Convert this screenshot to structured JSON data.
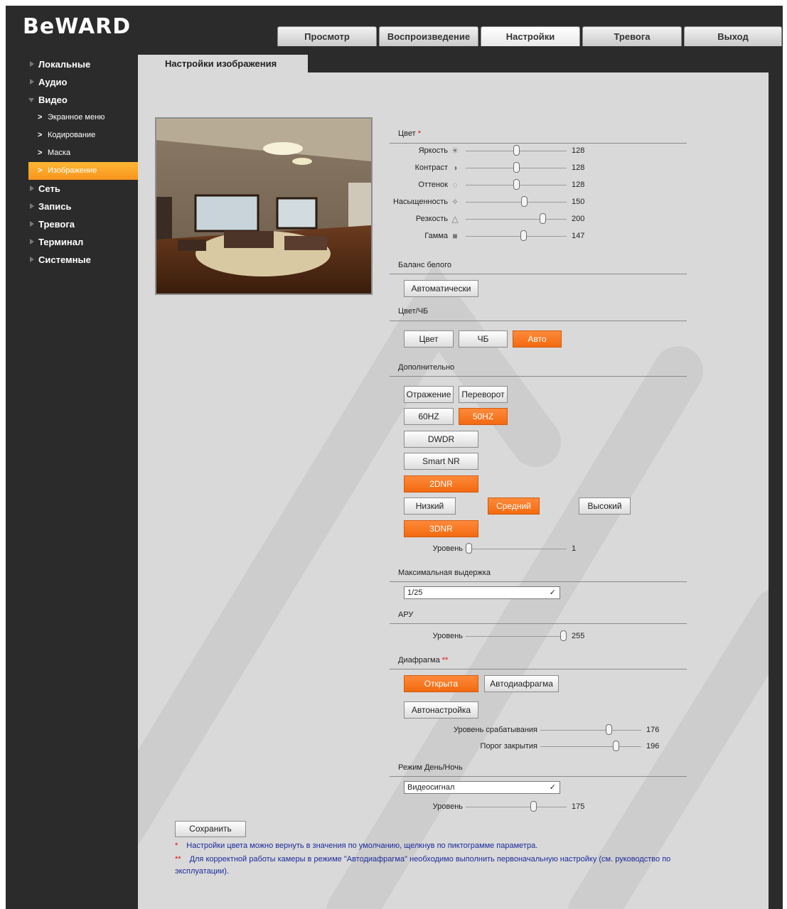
{
  "logo": "BeWARD",
  "tabs": [
    "Просмотр",
    "Воспроизведение",
    "Настройки",
    "Тревога",
    "Выход"
  ],
  "sidebar": {
    "items": [
      {
        "label": "Локальные"
      },
      {
        "label": "Аудио"
      },
      {
        "label": "Видео"
      },
      {
        "label": "Экранное меню"
      },
      {
        "label": "Кодирование"
      },
      {
        "label": "Маска"
      },
      {
        "label": "Изображение"
      },
      {
        "label": "Сеть"
      },
      {
        "label": "Запись"
      },
      {
        "label": "Тревога"
      },
      {
        "label": "Терминал"
      },
      {
        "label": "Системные"
      }
    ]
  },
  "content_tab": "Настройки изображения",
  "color": {
    "title": "Цвет",
    "required_mark": "*",
    "sliders": [
      {
        "label": "Яркость",
        "value": "128",
        "level": 128,
        "max": 255,
        "icon": "brightness-icon"
      },
      {
        "label": "Контраст",
        "value": "128",
        "level": 128,
        "max": 255,
        "icon": "contrast-icon"
      },
      {
        "label": "Оттенок",
        "value": "128",
        "level": 128,
        "max": 255,
        "icon": "hue-icon"
      },
      {
        "label": "Насыщенность",
        "value": "150",
        "level": 150,
        "max": 255,
        "icon": "saturation-icon"
      },
      {
        "label": "Резкость",
        "value": "200",
        "level": 200,
        "max": 255,
        "icon": "sharpness-icon"
      },
      {
        "label": "Гамма",
        "value": "147",
        "level": 147,
        "max": 255,
        "icon": "gamma-icon"
      }
    ]
  },
  "white_balance": {
    "title": "Баланс белого",
    "button": "Автоматически"
  },
  "color_bw": {
    "title": "Цвет/ЧБ",
    "buttons": [
      "Цвет",
      "ЧБ",
      "Авто"
    ],
    "active": "Авто"
  },
  "advanced": {
    "title": "Дополнительно",
    "mirror": "Отражение",
    "flip": "Переворот",
    "hz60": "60HZ",
    "hz50": "50HZ",
    "dwdr": "DWDR",
    "smart_nr": "Smart NR",
    "dnr2": "2DNR",
    "low": "Низкий",
    "medium": "Средний",
    "high": "Высокий",
    "dnr3": "3DNR",
    "level_label": "Уровень",
    "level_value": "1",
    "level": 1
  },
  "max_exposure": {
    "title": "Максимальная выдержка",
    "value": "1/25"
  },
  "agc": {
    "title": "АРУ",
    "level_label": "Уровень",
    "level_value": "255",
    "level": 255,
    "max": 255
  },
  "iris": {
    "title": "Диафрагма",
    "required_mark": "**",
    "open": "Открыта",
    "auto_iris": "Автодиафрагма",
    "auto_setup": "Автонастройка",
    "trigger_label": "Уровень срабатывания",
    "trigger_value": "176",
    "trigger_level": 176,
    "close_label": "Порог закрытия",
    "close_value": "196",
    "close_level": 196
  },
  "day_night": {
    "title": "Режим День/Ночь",
    "value": "Видеосигнал",
    "level_label": "Уровень",
    "level_value": "175",
    "level": 175
  },
  "save": "Сохранить",
  "notes": [
    {
      "mark": "*",
      "text": "Настройки цвета можно вернуть в значения по умолчанию, щелкнув по пиктограмме параметра."
    },
    {
      "mark": "**",
      "text": "Для корректной работы камеры в режиме \"Автодиафрагма\" необходимо выполнить первоначальную настройку (см. руководство по эксплуатации)."
    }
  ],
  "colors": {
    "accent": "#f7941d",
    "active_button": "#f26a10",
    "panel": "#d9d9d9",
    "header": "#2b2b2b"
  }
}
